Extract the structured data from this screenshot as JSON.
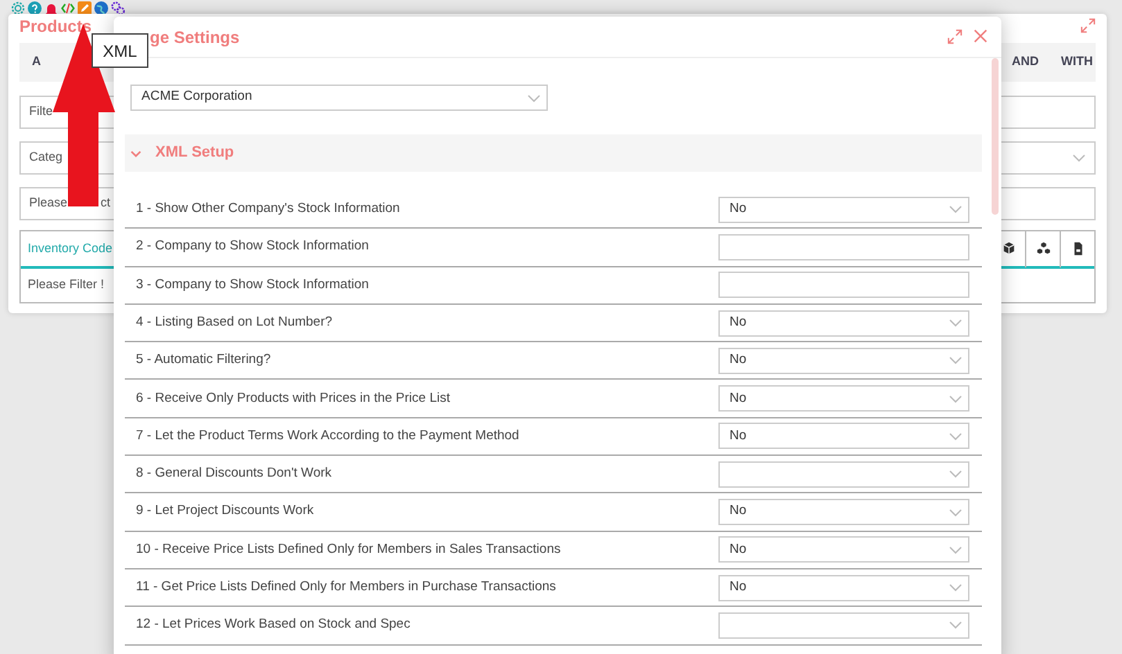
{
  "tooltip": {
    "text": "XML"
  },
  "products": {
    "title": "Products",
    "tabs": [
      "A",
      "AND",
      "WITH"
    ],
    "fields": [
      {
        "parts": [
          "Filte"
        ]
      },
      {
        "parts": [
          "Categ"
        ]
      },
      {
        "parts": [
          "Please",
          "ct"
        ]
      }
    ],
    "grid": {
      "column": "Inventory Code",
      "empty": "Please Filter !"
    }
  },
  "dialog": {
    "title": "ge Settings",
    "company": "ACME Corporation",
    "section": {
      "title": "XML Setup",
      "expanded": true
    },
    "rows": [
      {
        "label": "1 - Show Other Company's Stock Information",
        "kind": "select",
        "value": "No"
      },
      {
        "label": "2 - Company to Show Stock Information",
        "kind": "text"
      },
      {
        "label": "3 - Company to Show Stock Information",
        "kind": "text"
      },
      {
        "label": "4 - Listing Based on Lot Number?",
        "kind": "select",
        "value": "No"
      },
      {
        "label": "5 - Automatic Filtering?",
        "kind": "select",
        "value": "No"
      },
      {
        "label": "6 - Receive Only Products with Prices in the Price List",
        "kind": "select",
        "value": "No"
      },
      {
        "label": "7 - Let the Product Terms Work According to the Payment Method",
        "kind": "select",
        "value": "No"
      },
      {
        "label": "8 - General Discounts Don't Work",
        "kind": "select"
      },
      {
        "label": "9 - Let Project Discounts Work",
        "kind": "select",
        "value": "No"
      },
      {
        "label": "10 - Receive Price Lists Defined Only for Members in Sales Transactions",
        "kind": "select",
        "value": "No"
      },
      {
        "label": "11 - Get Price Lists Defined Only for Members in Purchase Transactions",
        "kind": "select",
        "value": "No"
      },
      {
        "label": "12 - Let Prices Work Based on Stock and Spec",
        "kind": "select"
      }
    ]
  }
}
